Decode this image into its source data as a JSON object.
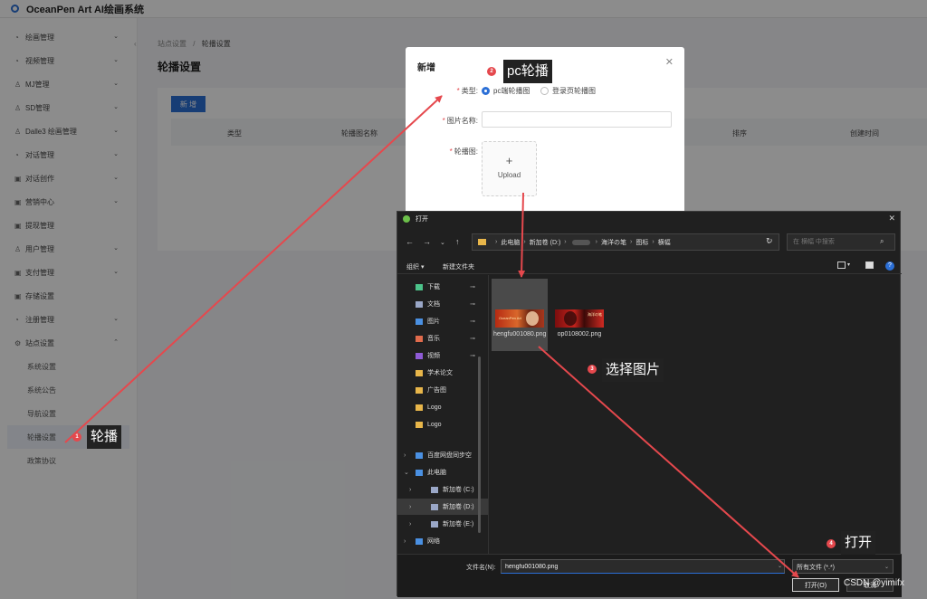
{
  "app": {
    "title": "OceanPen Art AI绘画系统",
    "sidebar": {
      "items": [
        {
          "icon": "◔",
          "label": "绘画管理",
          "expanded": false
        },
        {
          "icon": "◔",
          "label": "视频管理",
          "expanded": false
        },
        {
          "icon": "♙",
          "label": "MJ管理",
          "expanded": false
        },
        {
          "icon": "♙",
          "label": "SD管理",
          "expanded": false
        },
        {
          "icon": "♙",
          "label": "Dalle3 绘画管理",
          "expanded": false
        },
        {
          "icon": "◔",
          "label": "对话管理",
          "expanded": false
        },
        {
          "icon": "▣",
          "label": "对话创作",
          "expanded": false
        },
        {
          "icon": "▣",
          "label": "营销中心",
          "expanded": false
        },
        {
          "icon": "▣",
          "label": "提现管理",
          "expanded": null
        },
        {
          "icon": "♙",
          "label": "用户管理",
          "expanded": false
        },
        {
          "icon": "▣",
          "label": "支付管理",
          "expanded": false
        },
        {
          "icon": "▣",
          "label": "存储设置",
          "expanded": null
        },
        {
          "icon": "◔",
          "label": "注册管理",
          "expanded": false
        },
        {
          "icon": "⚙",
          "label": "站点设置",
          "expanded": true
        }
      ],
      "subitems": [
        {
          "label": "系统设置",
          "active": false
        },
        {
          "label": "系统公告",
          "active": false
        },
        {
          "label": "导航设置",
          "active": false
        },
        {
          "label": "轮播设置",
          "active": true
        },
        {
          "label": "政策协议",
          "active": false
        }
      ]
    },
    "breadcrumb": [
      "站点设置",
      "轮播设置"
    ],
    "page_title": "轮播设置",
    "add_button": "新 增",
    "table_columns": [
      "类型",
      "轮播图名称",
      "排序",
      "创建时间"
    ]
  },
  "dialog": {
    "title": "新增",
    "type_label": "类型:",
    "type_options": [
      {
        "label": "pc端轮播图",
        "selected": true
      },
      {
        "label": "登录页轮播图",
        "selected": false
      }
    ],
    "name_label": "图片名称:",
    "name_value": "",
    "image_label": "轮播图:",
    "upload_text": "Upload"
  },
  "file_dialog": {
    "title": "打开",
    "path": [
      "此电脑",
      "新加卷 (D:)",
      "海洋の笔",
      "图标",
      "横幅"
    ],
    "search_placeholder": "在 横幅 中搜索",
    "toolbar": {
      "organize": "组织 ▾",
      "new_folder": "新建文件夹"
    },
    "quick_access": [
      {
        "label": "下载",
        "pinned": true,
        "color": "#4cc38a"
      },
      {
        "label": "文档",
        "pinned": true,
        "color": "#9aa7c7"
      },
      {
        "label": "图片",
        "pinned": true,
        "color": "#4a90e2"
      },
      {
        "label": "音乐",
        "pinned": true,
        "color": "#e06b4c"
      },
      {
        "label": "视频",
        "pinned": true,
        "color": "#8f5bd6"
      },
      {
        "label": "学术论文",
        "pinned": false,
        "color": "#e8b64a"
      },
      {
        "label": "广告图",
        "pinned": false,
        "color": "#e8b64a"
      },
      {
        "label": "Logo",
        "pinned": false,
        "color": "#e8b64a"
      },
      {
        "label": "Logo",
        "pinned": false,
        "color": "#e8b64a"
      }
    ],
    "tree": [
      {
        "label": "百度网盘同步空",
        "arrow": "›",
        "indent": 0,
        "selected": false
      },
      {
        "label": "此电脑",
        "arrow": "⌄",
        "indent": 0,
        "selected": false
      },
      {
        "label": "新加卷 (C:)",
        "arrow": "›",
        "indent": 1,
        "selected": false
      },
      {
        "label": "新加卷 (D:)",
        "arrow": "›",
        "indent": 1,
        "selected": true
      },
      {
        "label": "新加卷 (E:)",
        "arrow": "›",
        "indent": 1,
        "selected": false
      },
      {
        "label": "网络",
        "arrow": "›",
        "indent": 0,
        "selected": false
      }
    ],
    "files": [
      {
        "name": "hengfu001080.png",
        "selected": true,
        "thumb_text": "OceanPen Art"
      },
      {
        "name": "op0108002.png",
        "selected": false,
        "thumb_text": "海洋の笔"
      }
    ],
    "filename_label": "文件名(N):",
    "filename_value": "hengfu001080.png",
    "filetype": "所有文件 (*.*)",
    "open_button": "打开(O)",
    "cancel_button": "取消"
  },
  "annotations": [
    {
      "step": "1",
      "text": "轮播"
    },
    {
      "step": "2",
      "text": "pc轮播"
    },
    {
      "step": "3",
      "text": "选择图片"
    },
    {
      "step": "4",
      "text": "打开"
    }
  ],
  "annotation_color": "#e5484d",
  "watermark": "CSDN @yimifx"
}
